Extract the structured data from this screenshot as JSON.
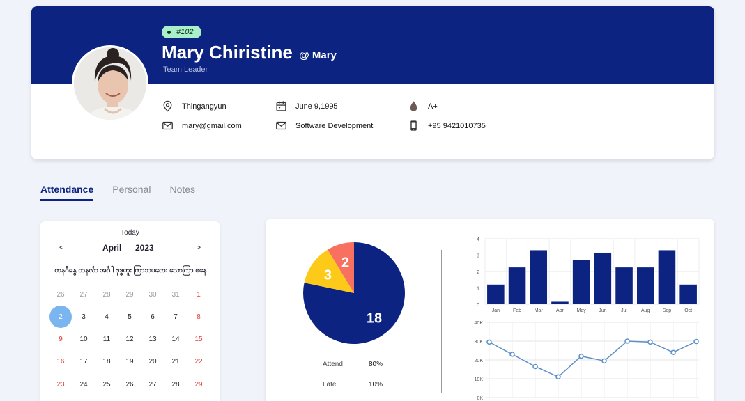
{
  "profile": {
    "id_badge": "#102",
    "name": "Mary Chiristine",
    "handle": "@ Mary",
    "role": "Team Leader",
    "info": {
      "location": "Thingangyun",
      "birthday": "June 9,1995",
      "blood_type": "A+",
      "email": "mary@gmail.com",
      "department": "Software Development",
      "phone": "+95 9421010735"
    }
  },
  "tabs": [
    "Attendance",
    "Personal",
    "Notes"
  ],
  "calendar": {
    "today_label": "Today",
    "prev": "<",
    "next": ">",
    "month": "April",
    "year": "2023",
    "weekdays": "တနင်္ဂနွေ တနင်္လာ အင်္ဂါ ဗုဒ္ဓဟူး ကြာသပတေး သောကြာ စနေ",
    "weeks": [
      [
        "26",
        "27",
        "28",
        "29",
        "30",
        "31",
        "1"
      ],
      [
        "2",
        "3",
        "4",
        "5",
        "6",
        "7",
        "8"
      ],
      [
        "9",
        "10",
        "11",
        "12",
        "13",
        "14",
        "15"
      ],
      [
        "16",
        "17",
        "18",
        "19",
        "20",
        "21",
        "22"
      ],
      [
        "23",
        "24",
        "25",
        "26",
        "27",
        "28",
        "29"
      ]
    ],
    "selected_day": "2"
  },
  "stats": {
    "attend_label": "Attend",
    "attend_value": "80%",
    "late_label": "Late",
    "late_value": "10%"
  },
  "colors": {
    "navy": "#0c2381",
    "salmon": "#f87060",
    "yellow": "#fdca1a",
    "line": "#5b8fc6"
  },
  "chart_data": [
    {
      "type": "pie",
      "values": [
        18,
        3,
        2
      ],
      "labels": [
        "18",
        "3",
        "2"
      ],
      "colors": [
        "#0c2381",
        "#fdca1a",
        "#f87060"
      ]
    },
    {
      "type": "bar",
      "categories": [
        "Jan",
        "Feb",
        "Mar",
        "Apr",
        "May",
        "Jun",
        "Jul",
        "Aug",
        "Sep",
        "Oct"
      ],
      "values": [
        1.2,
        2.25,
        3.3,
        0.15,
        2.7,
        3.15,
        2.25,
        2.25,
        3.3,
        1.2
      ],
      "yticks": [
        "0",
        "1",
        "2",
        "3",
        "4"
      ],
      "ylim": [
        0,
        4
      ],
      "color": "#0c2381",
      "grid": true
    },
    {
      "type": "line",
      "values": [
        29500,
        23000,
        16500,
        11000,
        22000,
        19500,
        30000,
        29500,
        24000,
        29800
      ],
      "yticks": [
        "0K",
        "10K",
        "20K",
        "30K",
        "40K"
      ],
      "ylim": [
        0,
        40000
      ],
      "color": "#5b8fc6",
      "grid": true
    }
  ]
}
